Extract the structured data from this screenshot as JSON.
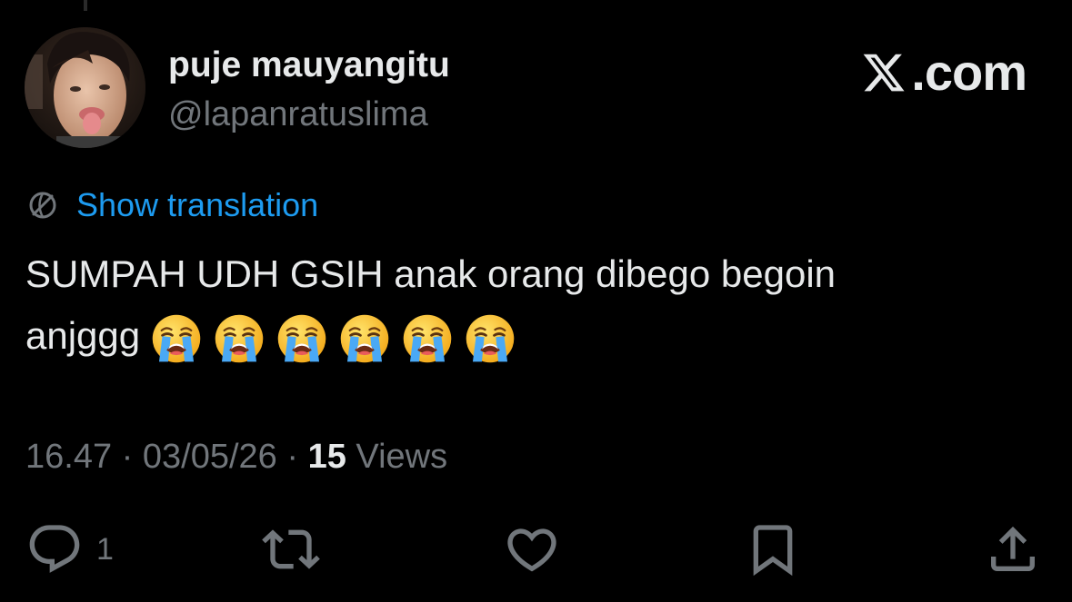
{
  "author": {
    "display_name": "puje mauyangitu",
    "handle": "@lapanratuslima"
  },
  "brand": {
    "text": ".com",
    "logo": "x-logo-icon"
  },
  "translation": {
    "icon": "globe-icon",
    "label": "Show translation"
  },
  "tweet": {
    "line1": "SUMPAH UDH GSIH anak orang dibego begoin",
    "line2": "anjggg",
    "emoji": [
      "😭",
      "😭",
      "😭",
      "😭",
      "😭",
      "😭"
    ]
  },
  "meta": {
    "time": "16.47",
    "separator": " · ",
    "date": "03/05/26",
    "views_count": "15",
    "views_label": "Views"
  },
  "actions": {
    "reply_count": "1",
    "icons": [
      "reply-icon",
      "retweet-icon",
      "like-icon",
      "bookmark-icon",
      "share-icon"
    ]
  },
  "colors": {
    "background": "#000000",
    "primary_text": "#e7e9ea",
    "secondary_text": "#71767b",
    "link": "#1d9bf0"
  }
}
